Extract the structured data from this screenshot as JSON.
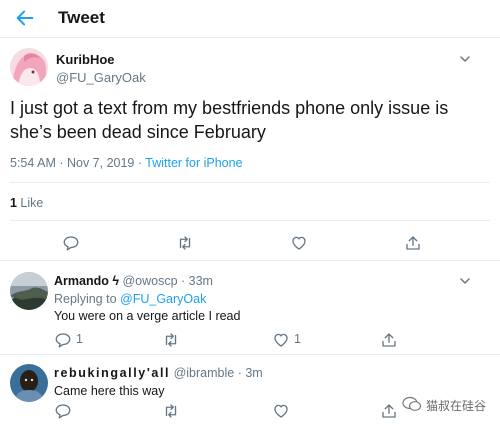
{
  "header": {
    "title": "Tweet",
    "back_icon": "arrow-left-icon",
    "accent": "#1da1f2"
  },
  "tweet": {
    "display_name": "KuribHoe",
    "handle": "@FU_GaryOak",
    "text": "I just got a text from my bestfriends phone only issue is she’s been dead since February",
    "time": "5:54 AM · Nov 7, 2019 · ",
    "source": "Twitter for iPhone",
    "like_count": "1",
    "like_label": " Like"
  },
  "replies": [
    {
      "display_name": "Armando ϟ",
      "handle": "@owoscp · 33m",
      "replying_prefix": "Replying to ",
      "replying_to": "@FU_GaryOak",
      "text": "You were on a verge article I read",
      "reply_count": "1",
      "like_count": "1"
    },
    {
      "display_name": "rebukingally'all",
      "handle": "@ibramble · 3m",
      "text": "Came here this way"
    }
  ],
  "watermark": {
    "text": "猫叔在硅谷"
  }
}
